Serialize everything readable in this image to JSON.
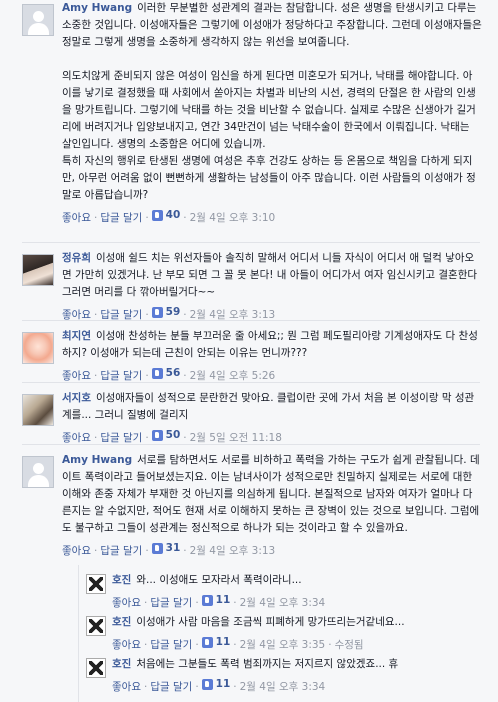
{
  "actions": {
    "like": "좋아요",
    "reply": "답글 달기",
    "edited": "수정됨"
  },
  "comments": [
    {
      "author": "Amy Hwang",
      "text": "이러한 무분별한 성관계의 결과는 참담합니다. 성은 생명을 탄생시키고 다루는 소중한 것입니다. 이성애자들은 그렇기에 이성애가 정당하다고 주장합니다. 그런데 이성애자들은 정말로 그렇게 생명을 소중하게 생각하지 않는 위선을 보여줍니다.\n\n의도치않게 준비되지 않은 여성이 임신을 하게 된다면 미혼모가 되거나, 낙태를 해야합니다. 아이를 낳기로 결정했을 때 사회에서 쏟아지는 차별과 비난의 시선, 경력의 단절은 한 사람의 인생을 망가트립니다. 그렇기에 낙태를 하는 것을 비난할 수 없습니다. 실제로 수많은 신생아가 길거리에 버려지거나 입양보내지고, 연간 34만건이 넘는 낙태수술이 한국에서 이뤄집니다. 낙태는 살인입니다. 생명의 소중함은 어디에 있습니까.\n특히 자신의 행위로 탄생된 생명에 여성은 추후 건강도 상하는 등 온몸으로 책임을 다하게 되지만, 아무런 어려움 없이 뻔뻔하게 생활하는 남성들이 아주 많습니다. 이런 사람들의 이성애가 정말로 아름답습니까?",
      "likes": "40",
      "time": "2월 4일 오후 3:10"
    },
    {
      "author": "정유희",
      "text": "이성애 쉴드 치는 위선자들아 솔직히 말해서 어디서 니들 자식이 어디서 애 덜컥 낳아오면 가만히 있겠거냐. 난 부모 되면 그 꼴 못 본다! 내 아들이 어디가서 여자 임신시키고 결혼한다 그러면 머리를 다 깎아버릴거다~~",
      "likes": "59",
      "time": "2월 4일 오후 3:13"
    },
    {
      "author": "최지연",
      "text": "이성애 찬성하는 분들 부끄러운 줄 아세요;; 뭔 그럼 페도필리아랑 기계성애자도 다 찬성하지? 이성애가 되는데 근친이 안되는 이유는 먼니까???",
      "likes": "56",
      "time": "2월 4일 오후 5:26"
    },
    {
      "author": "서지호",
      "text": "이성애자들이 성적으로 문란한건 맞아요. 클럽이란 곳에 가서 처음 본 이성이랑 막 성관계를... 그러니 질병에 걸리지",
      "likes": "50",
      "time": "2월 5일 오전 11:18"
    },
    {
      "author": "Amy Hwang",
      "text": "서로를 탐하면서도 서로를 비하하고 폭력을 가하는 구도가 쉽게 관찰됩니다. 데이트 폭력이라고 들어보셨는지요. 이는 남녀사이가 성적으로만 친밀하지 실제로는 서로에 대한 이해와 존중 자체가 부재한 것 아닌지를 의심하게 됩니다. 본질적으로 남자와 여자가 얼마나 다른지는 알 수없지만, 적어도 현재 서로 이해하지 못하는 큰 장벽이 있는 것으로 보입니다. 그럼에도 불구하고 그들이 성관계는 정신적으로 하나가 되는 것이라고 할 수 있을까요.",
      "likes": "31",
      "time": "2월 4일 오후 3:13"
    }
  ],
  "replies": [
    {
      "author": "호진",
      "text": "와... 이성애도 모자라서 폭력이라니...",
      "likes": "11",
      "time": "2월 4일 오후 3:34",
      "edited": false
    },
    {
      "author": "호진",
      "text": "이성애가 사람 마음을 조금씩 피폐하게 망가뜨리는거같네요...",
      "likes": "11",
      "time": "2월 4일 오후 3:35",
      "edited": true
    },
    {
      "author": "호진",
      "text": "처음에는 그분들도 폭력 범죄까지는 저지르지 않았겠죠... 휴",
      "likes": "11",
      "time": "2월 4일 오후 3:34",
      "edited": false
    }
  ]
}
